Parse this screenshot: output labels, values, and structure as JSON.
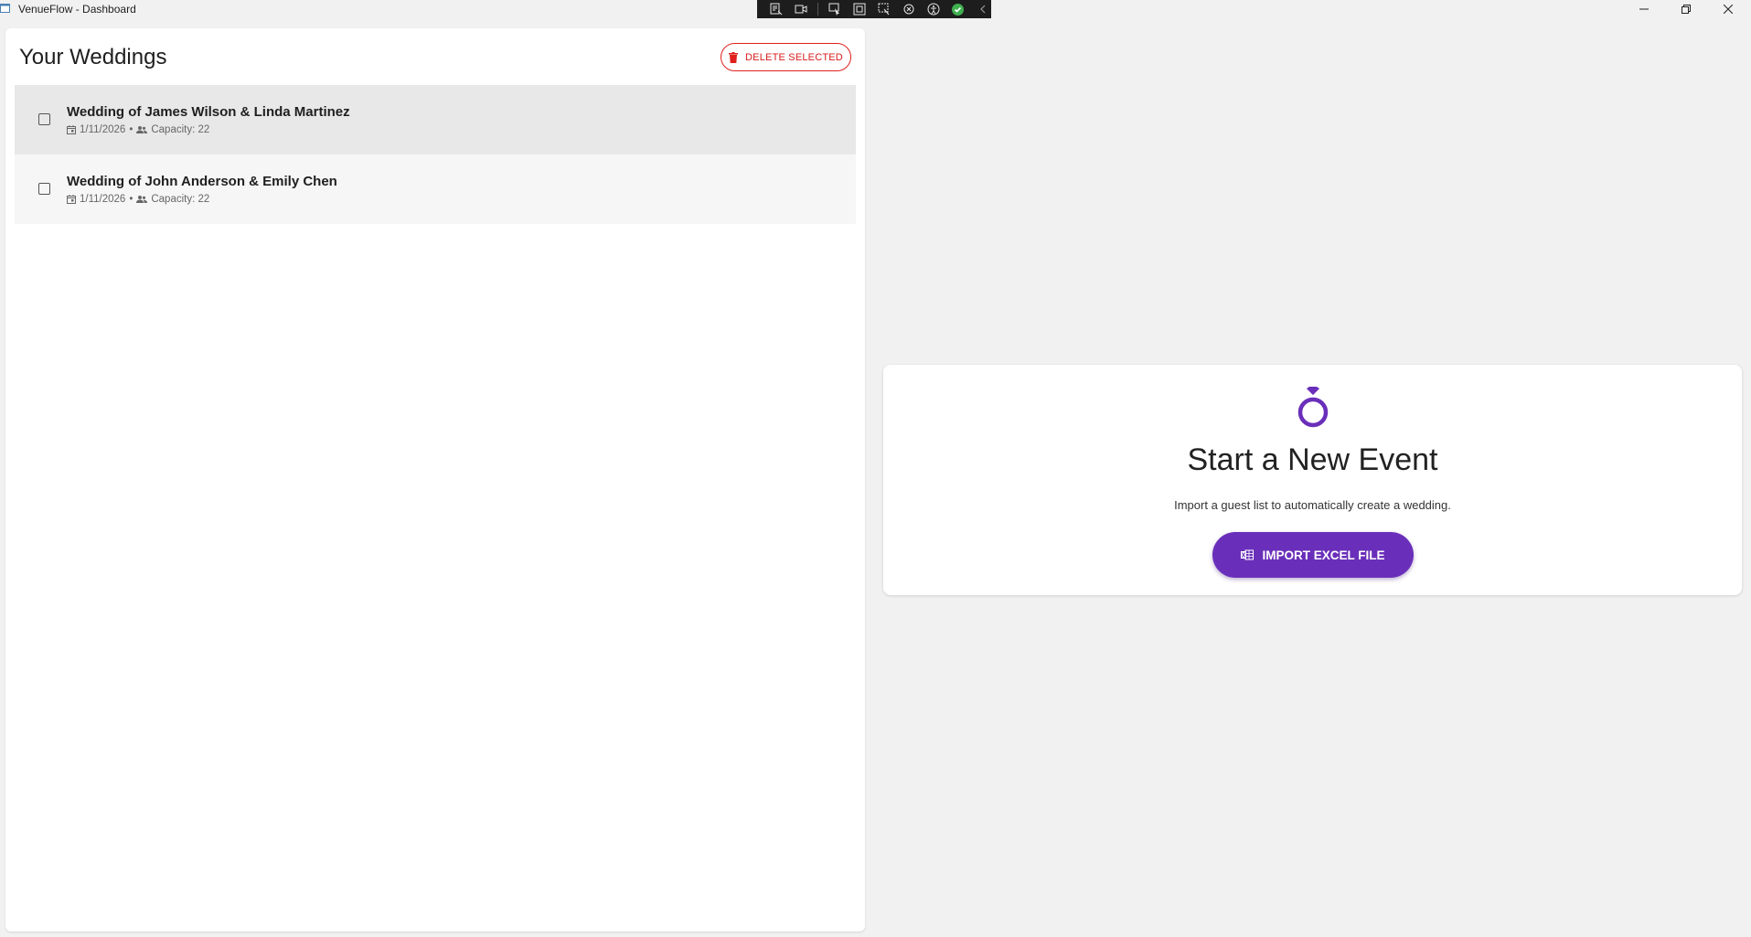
{
  "window": {
    "title": "VenueFlow - Dashboard"
  },
  "left_panel": {
    "title": "Your Weddings",
    "delete_button_label": "DELETE SELECTED",
    "weddings": [
      {
        "title": "Wedding of James Wilson & Linda Martinez",
        "date": "1/11/2026",
        "separator": "•",
        "capacity": "Capacity: 22",
        "checked": false
      },
      {
        "title": "Wedding of John Anderson & Emily Chen",
        "date": "1/11/2026",
        "separator": "•",
        "capacity": "Capacity: 22",
        "checked": false
      }
    ]
  },
  "event_card": {
    "title": "Start a New Event",
    "subtitle": "Import a guest list to automatically create a wedding.",
    "import_button_label": "IMPORT EXCEL FILE"
  },
  "colors": {
    "accent": "#6a2fba",
    "danger": "#e0201d",
    "background": "#f1f1f1"
  },
  "icons": {
    "ring": "ring-icon",
    "trash": "trash-icon",
    "excel": "excel-icon",
    "calendar": "calendar-icon",
    "people": "people-icon"
  }
}
